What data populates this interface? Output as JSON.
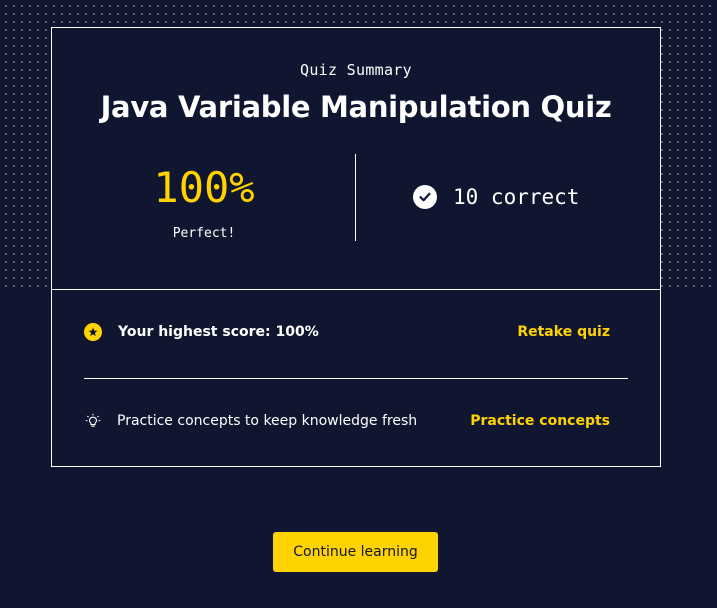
{
  "summary": {
    "eyebrow": "Quiz Summary",
    "title": "Java Variable Manipulation Quiz",
    "score_percent": "100%",
    "score_caption": "Perfect!",
    "correct_text": "10 correct"
  },
  "details": {
    "highest_score_text": "Your highest score: 100%",
    "retake_label": "Retake quiz",
    "practice_text": "Practice concepts to keep knowledge fresh",
    "practice_label": "Practice concepts"
  },
  "cta": {
    "label": "Continue learning"
  },
  "icons": {
    "check": "check-circle-icon",
    "star": "star-icon",
    "bulb": "lightbulb-icon"
  },
  "colors": {
    "background": "#10162f",
    "accent": "#ffd300",
    "text": "#ffffff"
  }
}
